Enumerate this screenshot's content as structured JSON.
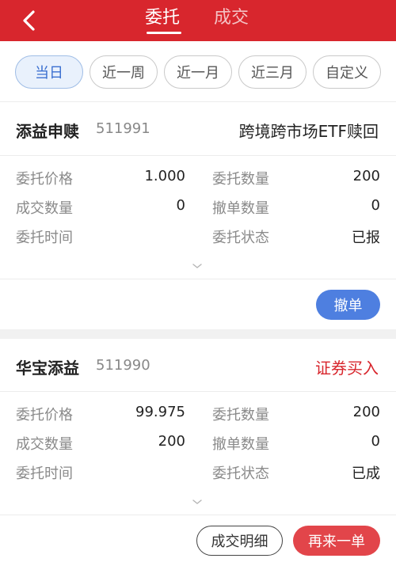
{
  "header": {
    "tabs": [
      {
        "label": "委托",
        "active": true
      },
      {
        "label": "成交",
        "active": false
      }
    ],
    "accent_color": "#d8262d"
  },
  "filters": [
    {
      "label": "当日",
      "active": true
    },
    {
      "label": "近一周",
      "active": false
    },
    {
      "label": "近一月",
      "active": false
    },
    {
      "label": "近三月",
      "active": false
    },
    {
      "label": "自定义",
      "active": false
    }
  ],
  "orders": [
    {
      "name": "添益申赎",
      "code": "511991",
      "type_label": "跨境跨市场ETF赎回",
      "rows": [
        {
          "label": "委托价格",
          "value": "1.000",
          "label2": "委托数量",
          "value2": "200"
        },
        {
          "label": "成交数量",
          "value": "0",
          "label2": "撤单数量",
          "value2": "0"
        },
        {
          "label": "委托时间",
          "value": "",
          "label2": "委托状态",
          "value2": "已报"
        }
      ],
      "buttons": [
        {
          "label": "撤单"
        }
      ]
    },
    {
      "name": "华宝添益",
      "code": "511990",
      "type_label": "证券买入",
      "rows": [
        {
          "label": "委托价格",
          "value": "99.975",
          "label2": "委托数量",
          "value2": "200"
        },
        {
          "label": "成交数量",
          "value": "200",
          "label2": "撤单数量",
          "value2": "0"
        },
        {
          "label": "委托时间",
          "value": "",
          "label2": "委托状态",
          "value2": "已成"
        }
      ],
      "buttons": [
        {
          "label": "成交明细"
        },
        {
          "label": "再来一单"
        }
      ]
    }
  ]
}
